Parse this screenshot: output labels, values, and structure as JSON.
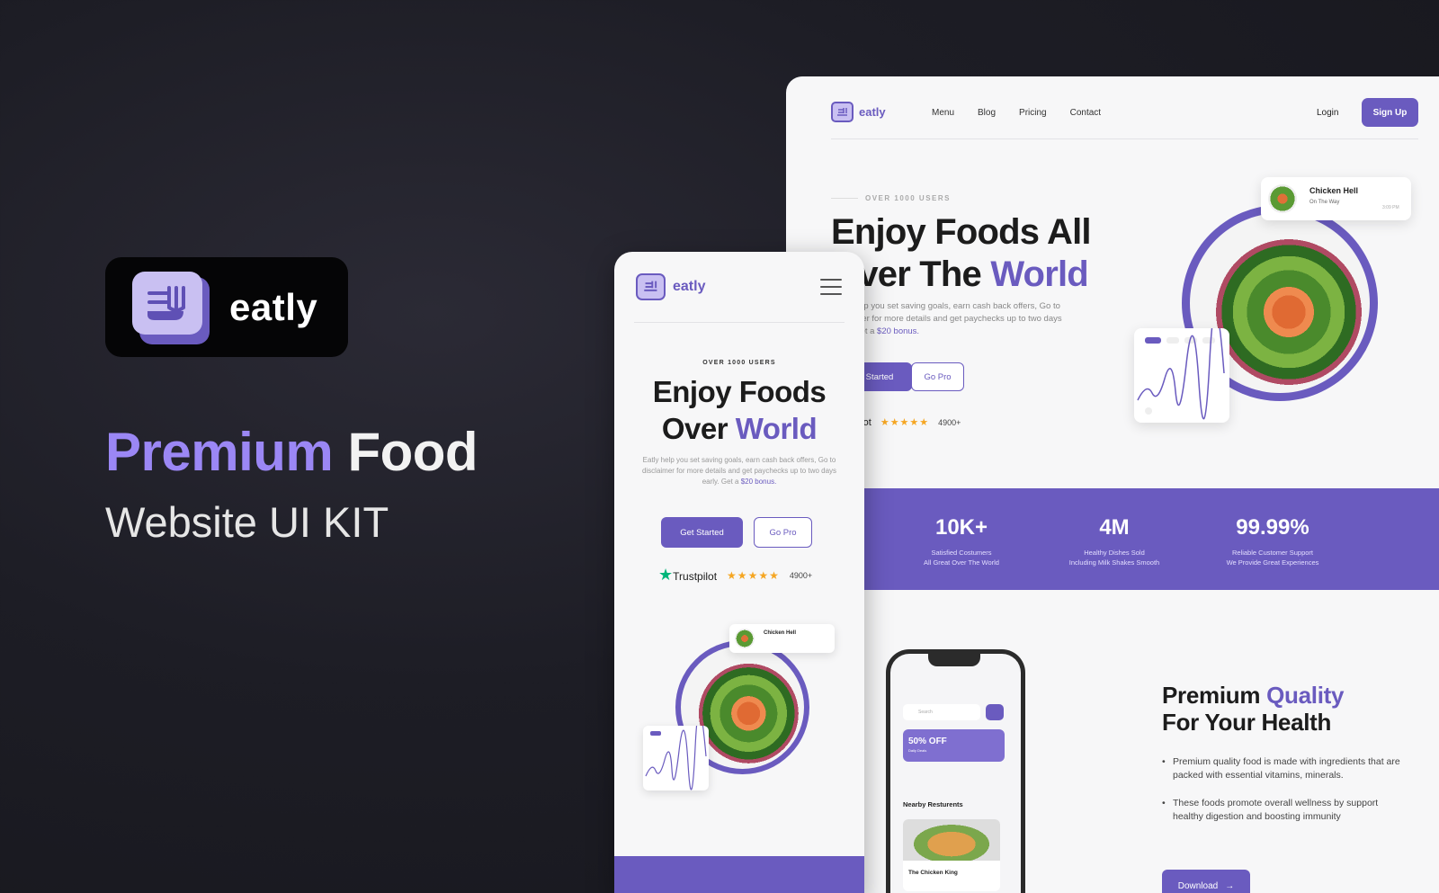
{
  "brand": {
    "name": "eatly",
    "headline_accent": "Premium",
    "headline_rest": "Food",
    "subheadline": "Website UI KIT"
  },
  "colors": {
    "accent": "#6a5bbf",
    "accent_light": "#9b87f5",
    "logo_tile": "#c9c0f2",
    "background": "#1d1d25",
    "stars": "#f5a623",
    "trustpilot": "#00b67a"
  },
  "desktop": {
    "logo_text": "eatly",
    "nav": [
      "Menu",
      "Blog",
      "Pricing",
      "Contact"
    ],
    "login_label": "Login",
    "signup_label": "Sign Up",
    "over_users": "OVER 1000 USERS",
    "hero_title_line1": "Enjoy Foods All",
    "hero_title_line2_plain": "Over The",
    "hero_title_line2_accent": "World",
    "hero_text": "Eatly help you set saving goals, earn cash back offers, Go to disclaimer for more details and get paychecks up to two days early. Get a",
    "hero_text_accent": "$20 bonus.",
    "get_started_label": "Get Started",
    "go_pro_label": "Go Pro",
    "trustpilot_label": "Trustpilot",
    "stars": "★★★★★",
    "rating_count": "4900+",
    "notification": {
      "title": "Chicken Hell",
      "subtitle": "On The Way",
      "time": "3:09 PM"
    },
    "stats": [
      {
        "value": "10K+",
        "line1": "Satisfied Costumers",
        "line2": "All Great Over The World"
      },
      {
        "value": "4M",
        "line1": "Healthy Dishes Sold",
        "line2": "Including Milk Shakes Smooth"
      },
      {
        "value": "99.99%",
        "line1": "Reliable Customer Support",
        "line2": "We Provide Great Experiences"
      }
    ],
    "phone": {
      "search_placeholder": "Search",
      "promo_title": "50% OFF",
      "promo_sub": "Daily Deals",
      "nearby_label": "Nearby Resturents",
      "restaurant_name": "The Chicken King"
    },
    "quality_title_plain1": "Premium",
    "quality_title_accent": "Quality",
    "quality_title_line2": "For Your Health",
    "bullets": [
      "Premium quality food is made with ingredients that are packed with essential vitamins, minerals.",
      "These foods promote overall wellness by support healthy digestion and boosting immunity"
    ],
    "download_label": "Download",
    "arrow_icon": "arrow-right-icon"
  },
  "mobile": {
    "logo_text": "eatly",
    "over_users": "OVER 1000 USERS",
    "title_line1": "Enjoy Foods",
    "title_line2_plain": "Over",
    "title_line2_accent": "World",
    "text": "Eatly help you set saving goals, earn cash back offers, Go to disclaimer for more details and get paychecks up to two days early. Get a",
    "text_accent": "$20 bonus.",
    "get_started_label": "Get Started",
    "go_pro_label": "Go Pro",
    "trustpilot_label": "Trustpilot",
    "stars": "★★★★★",
    "rating_count": "4900+",
    "notification_title": "Chicken Hell"
  }
}
